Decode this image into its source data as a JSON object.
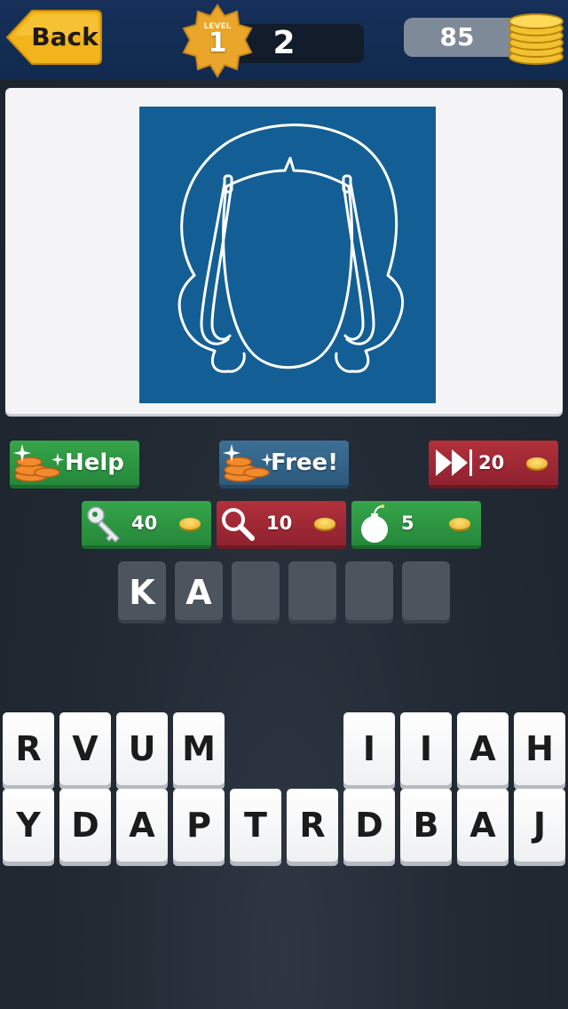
{
  "header": {
    "back_label": "Back",
    "level_word": "LEVEL",
    "level_badge": "1",
    "level_number": "2",
    "coins": "85"
  },
  "puzzle": {
    "image_icon": "hair-headband-outline-icon",
    "background": "#135f95"
  },
  "hints": {
    "help_label": "Help",
    "free_label": "Free!",
    "skip_cost": "20",
    "key_cost": "40",
    "magnifier_cost": "10",
    "bomb_cost": "5"
  },
  "answer": {
    "slots": [
      "K",
      "A",
      "",
      "",
      "",
      ""
    ]
  },
  "keyboard": {
    "row1": [
      "R",
      "V",
      "U",
      "M",
      "",
      "",
      "I",
      "I",
      "A",
      "H"
    ],
    "row2": [
      "Y",
      "D",
      "A",
      "P",
      "T",
      "R",
      "D",
      "B",
      "A",
      "J"
    ]
  },
  "colors": {
    "green_button": "#2f9a43",
    "blue_button": "#366689",
    "red_button": "#a12a35",
    "coin_gold": "#f2c230"
  }
}
